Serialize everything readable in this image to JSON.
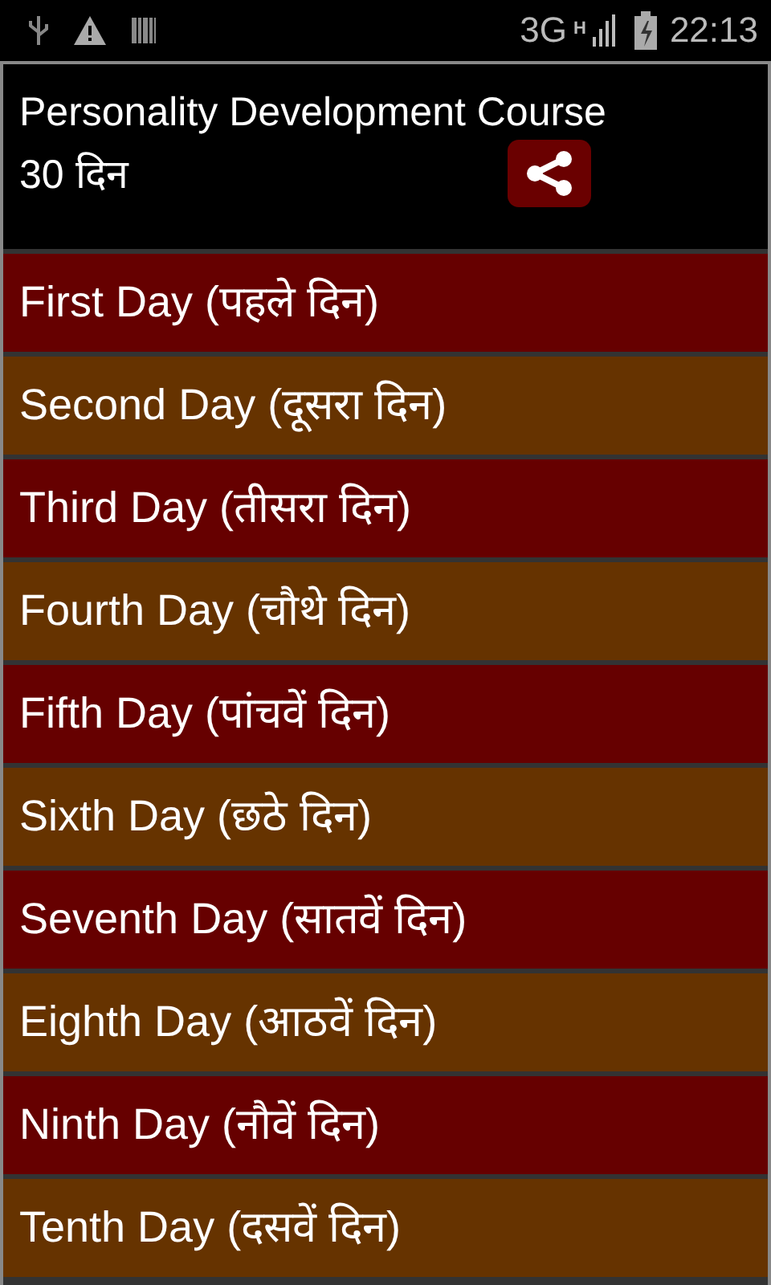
{
  "status_bar": {
    "network": "3G",
    "data_type": "H",
    "time": "22:13"
  },
  "header": {
    "title": "Personality Development Course",
    "subtitle": "30 दिन"
  },
  "days": [
    {
      "label": "First Day (पहले दिन)",
      "color": "#660000"
    },
    {
      "label": "Second Day (दूसरा दिन)",
      "color": "#663300"
    },
    {
      "label": "Third Day (तीसरा दिन)",
      "color": "#660000"
    },
    {
      "label": "Fourth Day (चौथे दिन)",
      "color": "#663300"
    },
    {
      "label": "Fifth Day (पांचवें दिन)",
      "color": "#660000"
    },
    {
      "label": "Sixth Day (छठे दिन)",
      "color": "#663300"
    },
    {
      "label": "Seventh Day (सातवें दिन)",
      "color": "#660000"
    },
    {
      "label": "Eighth Day (आठवें दिन)",
      "color": "#663300"
    },
    {
      "label": "Ninth Day (नौवें दिन)",
      "color": "#660000"
    },
    {
      "label": "Tenth Day (दसवें दिन)",
      "color": "#663300"
    }
  ]
}
